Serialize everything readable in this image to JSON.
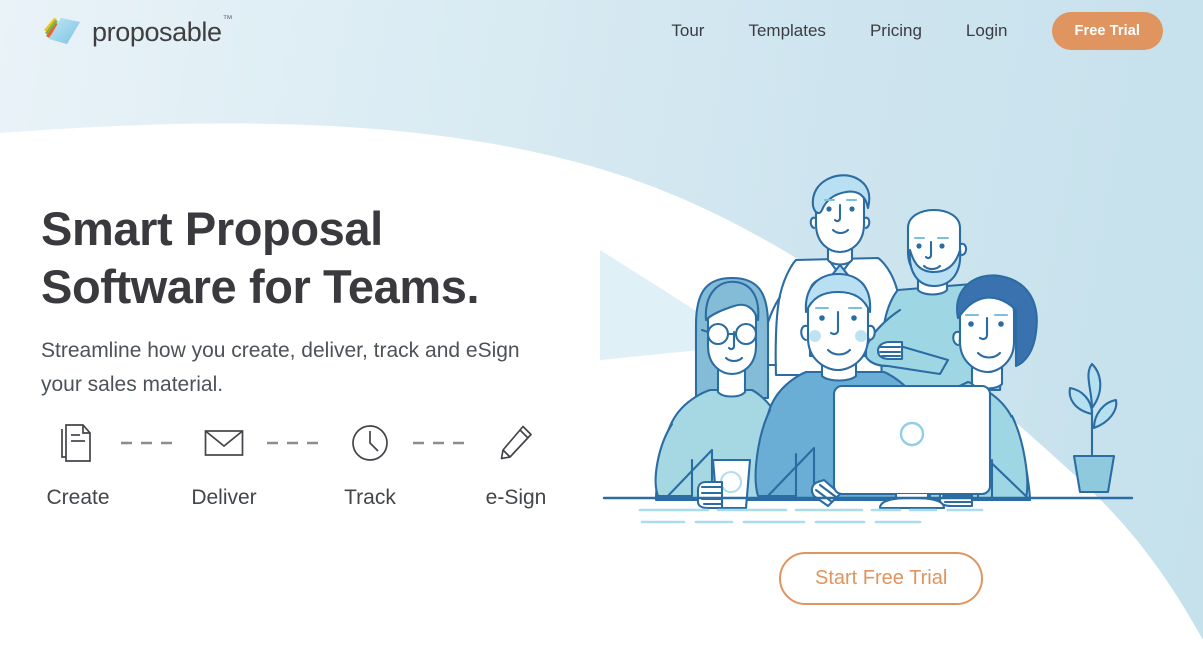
{
  "brand": {
    "name": "proposable",
    "trademark": "™",
    "logo_icon": "stacked-pages-logo"
  },
  "nav": {
    "links": [
      {
        "label": "Tour"
      },
      {
        "label": "Templates"
      },
      {
        "label": "Pricing"
      },
      {
        "label": "Login"
      }
    ],
    "cta_label": "Free Trial",
    "cta_color": "#e0945f"
  },
  "hero": {
    "headline_line1": "Smart Proposal",
    "headline_line2": "Software for Teams.",
    "subhead_line1": "Streamline how you create, deliver, track and",
    "subhead_line2": "eSign your sales material.",
    "headline_color": "#3a3a3e",
    "subhead_color": "#4c5357"
  },
  "steps": [
    {
      "label": "Create",
      "icon": "documents-icon"
    },
    {
      "label": "Deliver",
      "icon": "envelope-icon"
    },
    {
      "label": "Track",
      "icon": "clock-icon"
    },
    {
      "label": "e-Sign",
      "icon": "pencil-icon"
    }
  ],
  "cta": {
    "label": "Start Free Trial",
    "color": "#e0945f"
  },
  "illustration": {
    "name": "team-around-laptop-illustration",
    "elements": [
      "woman-with-glasses",
      "man-standing-back",
      "bald-bearded-man",
      "man-center-front",
      "man-right",
      "laptop",
      "coffee-cup",
      "potted-plant"
    ]
  },
  "background": {
    "gradient_start": "#e9f3f8",
    "gradient_end": "#c5e1ec",
    "curve_color": "#ffffff"
  }
}
